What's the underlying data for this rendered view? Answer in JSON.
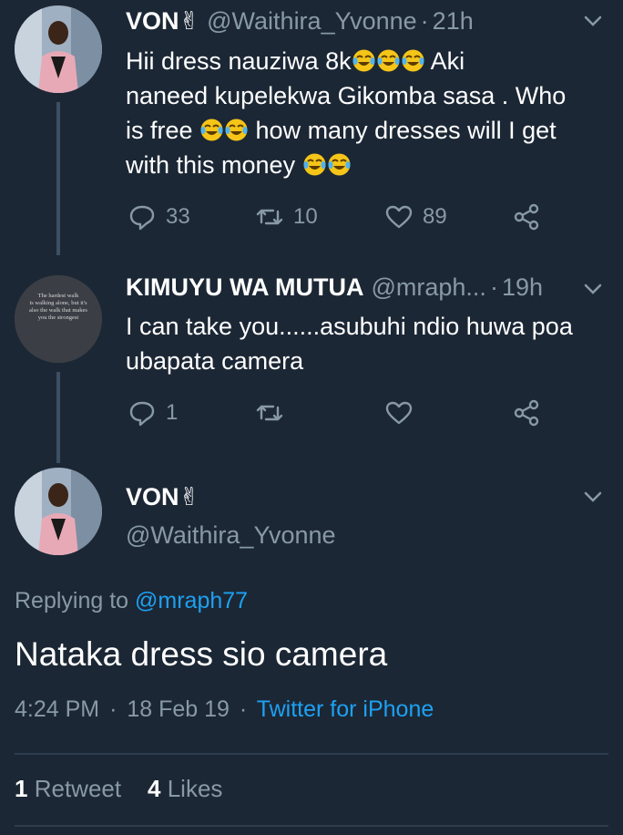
{
  "tweets": [
    {
      "name": "VON✌",
      "handle": "@Waithira_Yvonne",
      "time": "21h",
      "lines": [
        "Hii dress nauziwa  8k",
        " Aki",
        "naneed kupelekwa Gikomba sasa . Who",
        "is free ",
        " how many dresses will I get",
        "with this money "
      ],
      "actions": {
        "reply_count": "33",
        "retweet_count": "10",
        "like_count": "89"
      }
    },
    {
      "name": "KIMUYU WA MUTUA",
      "handle": "@mraph...",
      "time": "19h",
      "avatar_text": [
        "The hardest walk",
        "is walking alone, but it's",
        "also the walk that makes",
        "you the strongest"
      ],
      "lines": [
        "I can take you......asubuhi ndio huwa poa",
        "ubapata camera"
      ],
      "actions": {
        "reply_count": "1",
        "retweet_count": "",
        "like_count": ""
      }
    }
  ],
  "main": {
    "name": "VON✌",
    "handle": "@Waithira_Yvonne",
    "replying_prefix": "Replying to ",
    "replying_handle": "@mraph77",
    "text": "Nataka dress sio camera",
    "time": "4:24 PM",
    "date": "18 Feb 19",
    "source": "Twitter for iPhone",
    "retweets_count": "1",
    "retweets_label": "Retweet",
    "likes_count": "4",
    "likes_label": "Likes"
  },
  "colors": {
    "background": "#1c2735",
    "secondary_text": "#8899a6",
    "link": "#1da1f2"
  }
}
